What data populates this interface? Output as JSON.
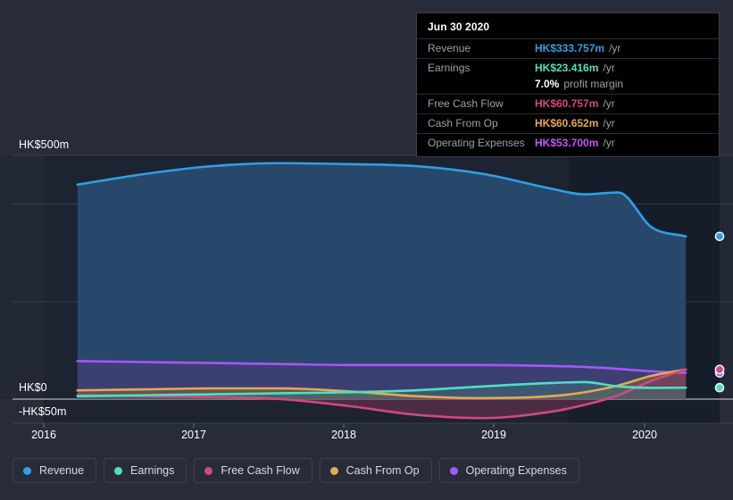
{
  "chart_data": {
    "type": "area",
    "title": "",
    "xlabel": "",
    "ylabel": "",
    "currency": "HK$",
    "units": "m",
    "ylim": [
      -50,
      500
    ],
    "grid": true,
    "legend_position": "bottom-left",
    "y_ticks": [
      {
        "value": 500,
        "label": "HK$500m"
      },
      {
        "value": 0,
        "label": "HK$0"
      },
      {
        "value": -50,
        "label": "-HK$50m"
      }
    ],
    "x_ticks": [
      "2016",
      "2017",
      "2018",
      "2019",
      "2020"
    ],
    "x_range": [
      "2015-09",
      "2020-09"
    ],
    "forecast_boundary": "2019-10",
    "series": [
      {
        "name": "Revenue",
        "color": "#2f9fe5",
        "fill": "#27486b",
        "x": [
          "2015-12",
          "2016-06",
          "2016-12",
          "2017-06",
          "2017-12",
          "2018-06",
          "2018-12",
          "2019-06",
          "2019-09",
          "2019-12",
          "2020-03",
          "2020-06"
        ],
        "values": [
          440,
          462,
          478,
          484,
          482,
          478,
          462,
          432,
          420,
          424,
          352,
          333.757
        ]
      },
      {
        "name": "Earnings",
        "color": "#4de0c0",
        "fill": "#3d6f76",
        "x": [
          "2015-12",
          "2016-06",
          "2016-12",
          "2017-06",
          "2017-12",
          "2018-06",
          "2018-12",
          "2019-06",
          "2019-09",
          "2019-12",
          "2020-03",
          "2020-06"
        ],
        "values": [
          6,
          8,
          10,
          12,
          14,
          18,
          26,
          33,
          35,
          26,
          23,
          23.416
        ]
      },
      {
        "name": "Free Cash Flow",
        "color": "#d1497f",
        "fill": "#7a3557",
        "x": [
          "2015-12",
          "2016-06",
          "2016-12",
          "2017-06",
          "2017-12",
          "2018-06",
          "2018-12",
          "2019-06",
          "2019-09",
          "2019-12",
          "2020-03",
          "2020-06"
        ],
        "values": [
          8,
          6,
          4,
          0,
          -14,
          -32,
          -39,
          -26,
          -12,
          8,
          38,
          60.757
        ]
      },
      {
        "name": "Cash From Op",
        "color": "#e8a84e",
        "fill": "#8a6a3c",
        "x": [
          "2015-12",
          "2016-06",
          "2016-12",
          "2017-06",
          "2017-12",
          "2018-06",
          "2018-12",
          "2019-06",
          "2019-09",
          "2019-12",
          "2020-03",
          "2020-06"
        ],
        "values": [
          18,
          20,
          22,
          22,
          16,
          6,
          2,
          6,
          14,
          28,
          48,
          60.652
        ]
      },
      {
        "name": "Operating Expenses",
        "color": "#a855f7",
        "fill": "#4b3a78",
        "x": [
          "2015-12",
          "2016-06",
          "2016-12",
          "2017-06",
          "2017-12",
          "2018-06",
          "2018-12",
          "2019-06",
          "2019-09",
          "2019-12",
          "2020-03",
          "2020-06"
        ],
        "values": [
          78,
          76,
          74,
          72,
          70,
          70,
          70,
          68,
          66,
          62,
          57,
          53.7
        ]
      }
    ]
  },
  "tooltip": {
    "date": "Jun 30 2020",
    "rows": [
      {
        "label": "Revenue",
        "value": "HK$333.757m",
        "unit": "/yr",
        "color": "#2f9fe5"
      },
      {
        "label": "Earnings",
        "value": "HK$23.416m",
        "unit": "/yr",
        "color": "#4de0c0"
      },
      {
        "label": "Free Cash Flow",
        "value": "HK$60.757m",
        "unit": "/yr",
        "color": "#d1497f"
      },
      {
        "label": "Cash From Op",
        "value": "HK$60.652m",
        "unit": "/yr",
        "color": "#e8a84e"
      },
      {
        "label": "Operating Expenses",
        "value": "HK$53.700m",
        "unit": "/yr",
        "color": "#c653f7"
      }
    ],
    "margin": {
      "value": "7.0%",
      "text": "profit margin"
    }
  },
  "legend": {
    "items": [
      {
        "label": "Revenue",
        "color": "#2f9fe5"
      },
      {
        "label": "Earnings",
        "color": "#4de0c0"
      },
      {
        "label": "Free Cash Flow",
        "color": "#d1497f"
      },
      {
        "label": "Cash From Op",
        "color": "#e8a84e"
      },
      {
        "label": "Operating Expenses",
        "color": "#a855f7"
      }
    ]
  }
}
